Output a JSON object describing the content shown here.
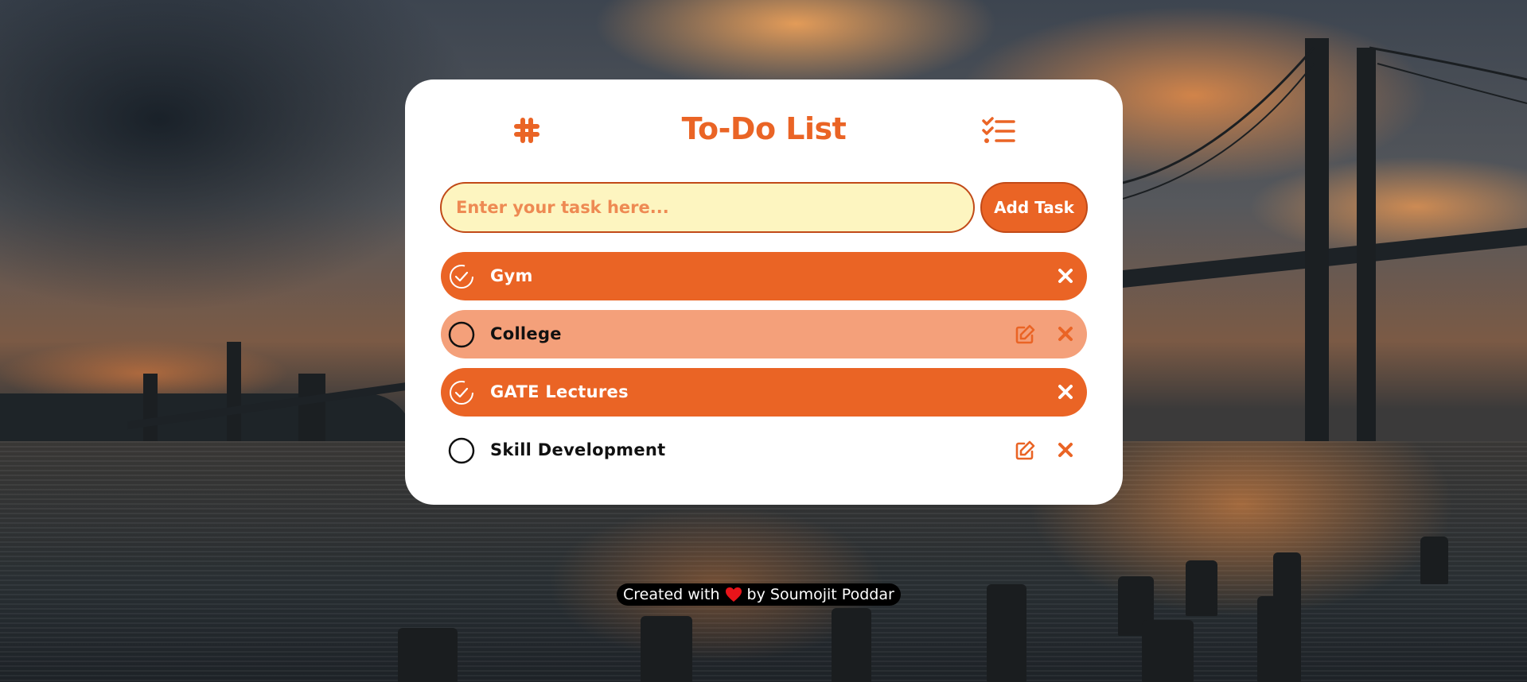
{
  "app": {
    "title": "To-Do List",
    "accent_color": "#ea6425",
    "logo_icon": "slack-hash-icon",
    "menu_icon": "checklist-icon"
  },
  "input": {
    "placeholder": "Enter your task here...",
    "value": ""
  },
  "add_button": {
    "label": "Add Task"
  },
  "tasks": [
    {
      "label": "Gym",
      "completed": true,
      "editable": false,
      "delete_icon": "close-icon"
    },
    {
      "label": "College",
      "completed": false,
      "editable": true,
      "delete_icon": "close-icon",
      "highlighted": true
    },
    {
      "label": "GATE Lectures",
      "completed": true,
      "editable": false,
      "delete_icon": "close-icon"
    },
    {
      "label": "Skill Development",
      "completed": false,
      "editable": true,
      "delete_icon": "close-icon"
    }
  ],
  "footer": {
    "prefix": "Created with",
    "heart_icon": "heart-icon",
    "suffix": "by Soumojit Poddar"
  }
}
